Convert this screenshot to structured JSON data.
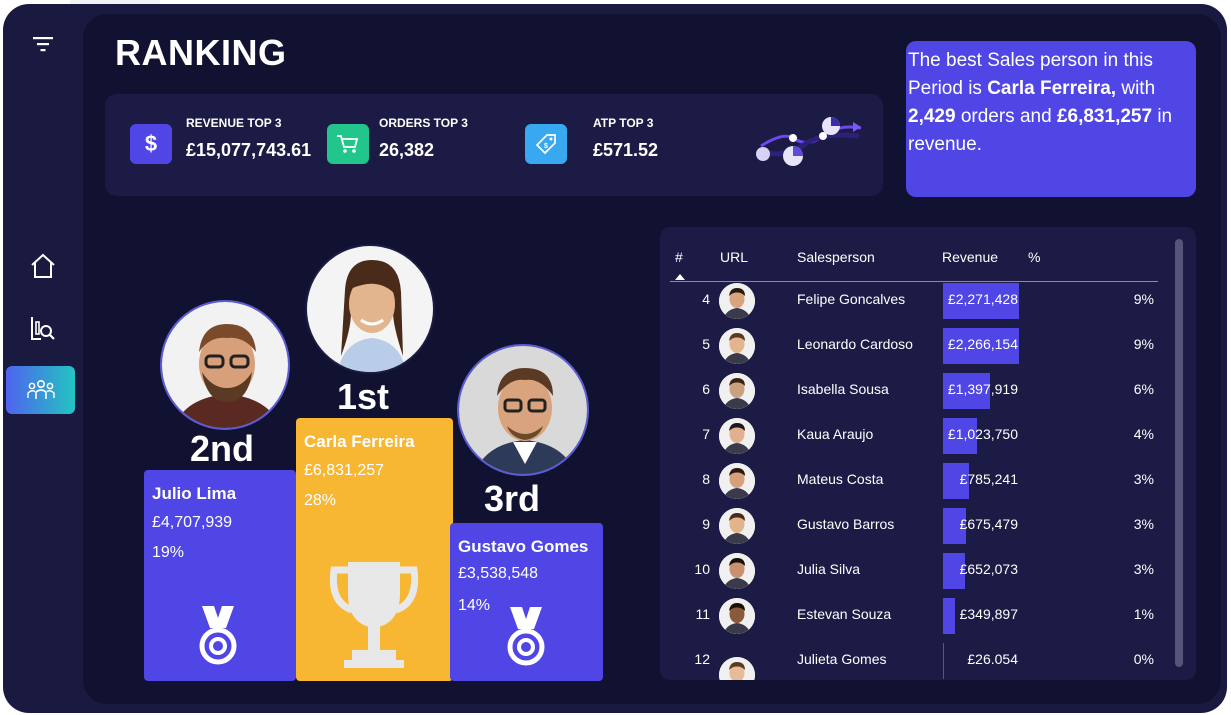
{
  "page": {
    "title": "RANKING"
  },
  "sidebar": {
    "items": [
      {
        "icon": "filter-icon"
      },
      {
        "icon": "home-icon"
      },
      {
        "icon": "chart-search-icon"
      },
      {
        "icon": "team-icon",
        "active": true
      }
    ]
  },
  "kpis": [
    {
      "label": "REVENUE TOP 3",
      "value": "£15,077,743.61",
      "icon": "dollar-icon",
      "color": "#4f46e5"
    },
    {
      "label": "ORDERS TOP 3",
      "value": "26,382",
      "icon": "cart-icon",
      "color": "#22c58b"
    },
    {
      "label": "ATP TOP 3",
      "value": "£571.52",
      "icon": "price-tag-icon",
      "color": "#38a8f0"
    }
  ],
  "callout": {
    "line1": "The best Sales person in this Period is ",
    "name": "Carla Ferreira,",
    "line2": " with ",
    "orders": "2,429",
    "line3": " orders and ",
    "revenue": "£6,831,257",
    "line4": " in revenue."
  },
  "podium": {
    "first": {
      "place": "1st",
      "name": "Carla Ferreira",
      "revenue": "£6,831,257",
      "share": "28%",
      "color": "#f8b733"
    },
    "second": {
      "place": "2nd",
      "name": "Julio Lima",
      "revenue": "£4,707,939",
      "share": "19%",
      "color": "#4f46e5"
    },
    "third": {
      "place": "3rd",
      "name": "Gustavo Gomes",
      "revenue": "£3,538,548",
      "share": "14%",
      "color": "#4f46e5"
    }
  },
  "table": {
    "headers": {
      "rank": "#",
      "url": "URL",
      "salesperson": "Salesperson",
      "revenue": "Revenue",
      "pct": "%"
    },
    "max_revenue": 2271428,
    "rows": [
      {
        "rank": "4",
        "name": "Felipe Goncalves",
        "revenue": "£2,271,428",
        "value": 2271428,
        "pct": "9%"
      },
      {
        "rank": "5",
        "name": "Leonardo Cardoso",
        "revenue": "£2,266,154",
        "value": 2266154,
        "pct": "9%"
      },
      {
        "rank": "6",
        "name": "Isabella Sousa",
        "revenue": "£1,397,919",
        "value": 1397919,
        "pct": "6%"
      },
      {
        "rank": "7",
        "name": "Kaua Araujo",
        "revenue": "£1,023,750",
        "value": 1023750,
        "pct": "4%"
      },
      {
        "rank": "8",
        "name": "Mateus Costa",
        "revenue": "£785,241",
        "value": 785241,
        "pct": "3%"
      },
      {
        "rank": "9",
        "name": "Gustavo Barros",
        "revenue": "£675,479",
        "value": 675479,
        "pct": "3%"
      },
      {
        "rank": "10",
        "name": "Julia Silva",
        "revenue": "£652,073",
        "value": 652073,
        "pct": "3%"
      },
      {
        "rank": "11",
        "name": "Estevan Souza",
        "revenue": "£349,897",
        "value": 349897,
        "pct": "1%"
      },
      {
        "rank": "12",
        "name": "Julieta Gomes",
        "revenue": "£26.054",
        "value": 26054,
        "pct": "0%"
      }
    ]
  }
}
